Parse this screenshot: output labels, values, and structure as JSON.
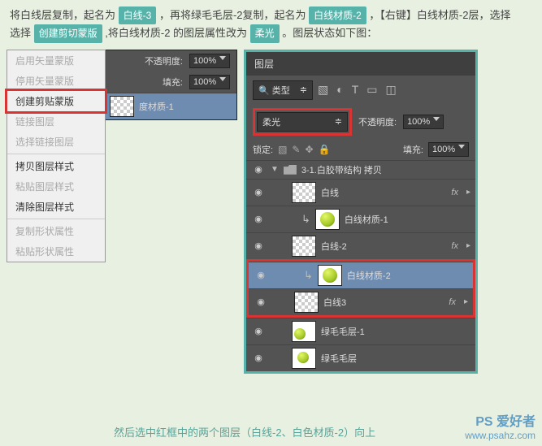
{
  "instruction": {
    "part1": "将白线层复制，起名为",
    "tag1": "白线-3",
    "part2": "，再将绿毛毛层-2复制，起名为",
    "tag2": "白线材质-2",
    "part3": "，【右键】白线材质-2层，选择",
    "tag3": "创建剪切蒙版",
    "part4": "，将白线材质-2 的图层属性改为",
    "tag4": "柔光",
    "part5": "。图层状态如下图："
  },
  "context_menu": {
    "item_hidden1": "启用矢量蒙版",
    "item_hidden2": "停用矢量蒙版",
    "item_create_clip": "创建剪贴蒙版",
    "item_link": "链接图层",
    "item_select_link": "选择链接图层",
    "item_copy_style": "拷贝图层样式",
    "item_paste_style": "粘贴图层样式",
    "item_clear_style": "清除图层样式",
    "item_copy_shape": "复制形状属性",
    "item_paste_shape": "粘贴形状属性"
  },
  "left_partial": {
    "opacity_label": "不透明度:",
    "opacity_val": "100%",
    "fill_label": "填充:",
    "fill_val": "100%",
    "layer_name": "度材质-1"
  },
  "layers_panel": {
    "title": "图层",
    "filter_type": "类型",
    "blend_mode": "柔光",
    "opacity_label": "不透明度:",
    "opacity_val": "100%",
    "lock_label": "锁定:",
    "fill_label": "填充:",
    "fill_val": "100%",
    "group_name": "3-1.白胶带结构 拷贝",
    "l_baixian": "白线",
    "l_baixian_mat1": "白线材质-1",
    "l_baixian2": "白线-2",
    "l_baixian_mat2": "白线材质-2",
    "l_baixian3": "白线3",
    "l_lvmao1": "绿毛毛层-1",
    "l_lvmao": "绿毛毛层",
    "fx": "fx"
  },
  "bottom_text": "然后选中红框中的两个图层（白线-2、白色材质-2）向上",
  "watermark": {
    "cn": "PS 爱好者",
    "en": "www.psahz.com"
  }
}
